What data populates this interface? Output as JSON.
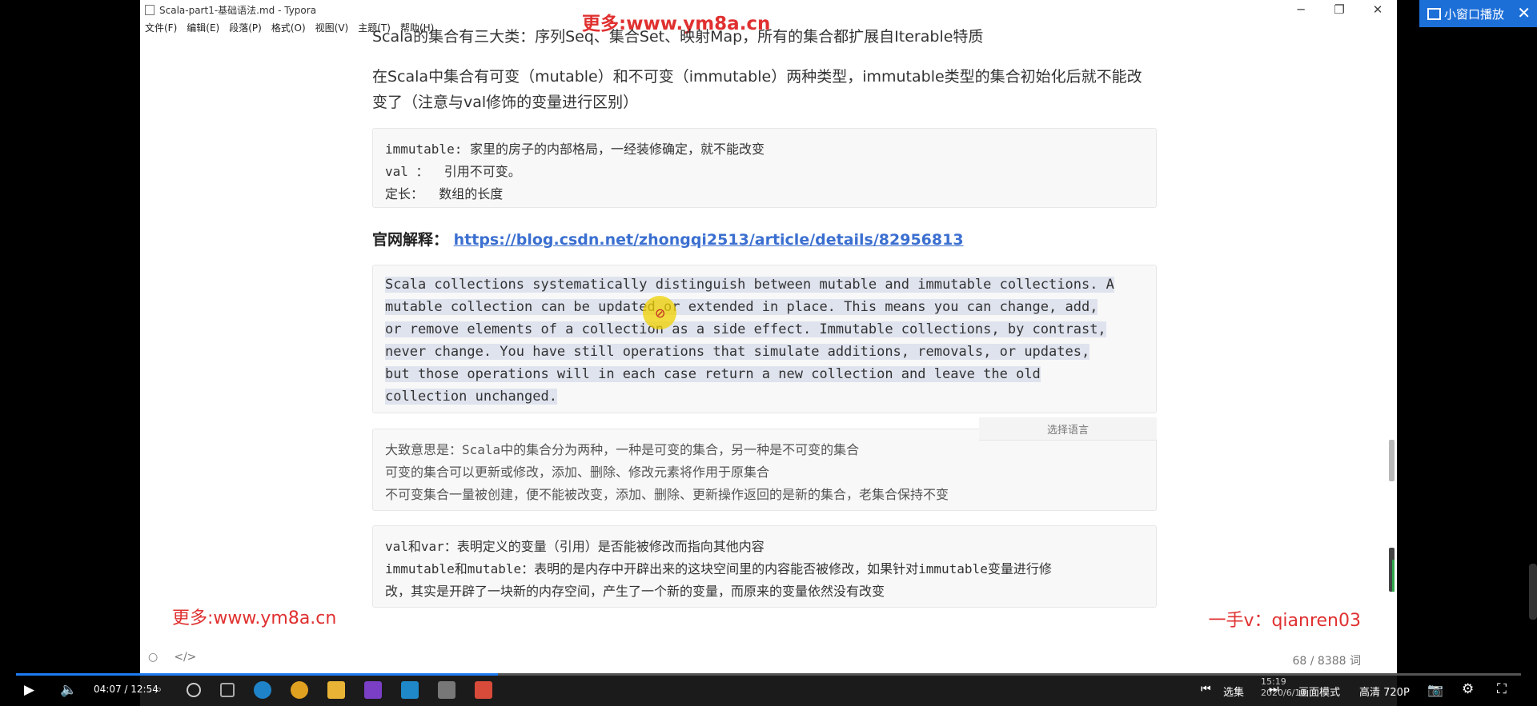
{
  "window": {
    "title": "Scala-part1-基础语法.md - Typora",
    "menu": [
      "文件(F)",
      "编辑(E)",
      "段落(P)",
      "格式(O)",
      "视图(V)",
      "主题(T)",
      "帮助(H)"
    ]
  },
  "watermarks": {
    "top": "更多:www.ym8a.cn",
    "left": "更多:www.ym8a.cn",
    "right": "一手v：qianren03"
  },
  "doc": {
    "cut_para": "Scala的集合有三大类：序列Seq、集合Set、映射Map，所有的集合都扩展自Iterable特质",
    "para2_line1": "在Scala中集合有可变（mutable）和不可变（immutable）两种类型，immutable类型的集合初始化后就不能改",
    "para2_line2": "变了（注意与val修饰的变量进行区别）",
    "box1": [
      "immutable: 家里的房子的内部格局，一经装修确定，就不能改变",
      "val ：  引用不可变。",
      "定长：  数组的长度"
    ],
    "official_label": "官网解释：",
    "official_link": "https://blog.csdn.net/zhongqi2513/article/details/82956813",
    "box2": [
      "Scala collections systematically distinguish between mutable and immutable collections. A",
      "mutable collection can be updated or extended in place. This means you can change, add,",
      "or remove elements of a collection as a side effect. Immutable collections, by contrast,",
      "never change. You have still operations that simulate additions, removals, or updates,",
      "but those operations will in each case return a new collection and leave the old",
      "collection unchanged."
    ],
    "lang_select": "选择语言",
    "box3": [
      "大致意思是：Scala中的集合分为两种，一种是可变的集合，另一种是不可变的集合",
      "可变的集合可以更新或修改，添加、删除、修改元素将作用于原集合",
      "不可变集合一量被创建，便不能被改变，添加、删除、更新操作返回的是新的集合，老集合保持不变"
    ],
    "box4": [
      "val和var：表明定义的变量（引用）是否能被修改而指向其他内容",
      "immutable和mutable：表明的是内存中开辟出来的这块空间里的内容能否被修改，如果针对immutable变量进行修",
      "改，其实是开辟了一块新的内存空间，产生了一个新的变量，而原来的变量依然没有改变"
    ],
    "word_count": "68 / 8388 词"
  },
  "player": {
    "mini_window": "小窗口播放",
    "time": "04:07 / 12:54",
    "progress": 0.32,
    "select_episode": "选集",
    "picture_mode": "画面模式",
    "quality": "高清 720P",
    "accent": "#1d7cf2"
  },
  "taskbar": {
    "clock_time": "15:19",
    "clock_date": "2020/6/10"
  }
}
